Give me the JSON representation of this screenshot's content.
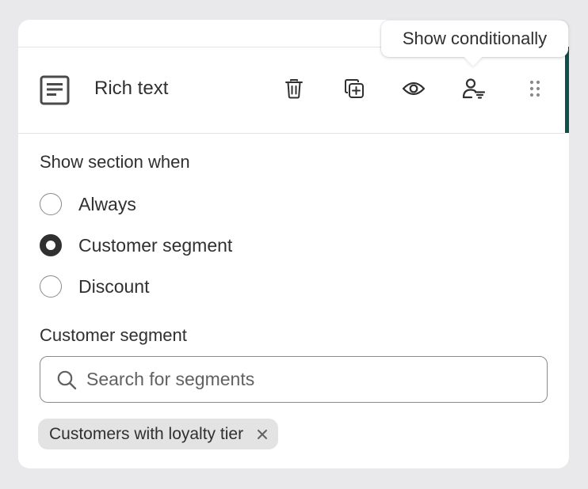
{
  "tooltip": {
    "text": "Show conditionally"
  },
  "section": {
    "title": "Rich text",
    "icon": "text-block-icon",
    "actions": [
      {
        "name": "delete",
        "icon": "trash-icon"
      },
      {
        "name": "duplicate",
        "icon": "duplicate-icon"
      },
      {
        "name": "visibility",
        "icon": "eye-icon"
      },
      {
        "name": "show-conditionally",
        "icon": "person-filter-icon"
      },
      {
        "name": "drag",
        "icon": "drag-handle-icon"
      }
    ]
  },
  "condition": {
    "heading": "Show section when",
    "options": [
      {
        "label": "Always",
        "checked": false
      },
      {
        "label": "Customer segment",
        "checked": true
      },
      {
        "label": "Discount",
        "checked": false
      }
    ]
  },
  "segment": {
    "heading": "Customer segment",
    "search_placeholder": "Search for segments",
    "search_value": "",
    "selected": [
      {
        "label": "Customers with loyalty tier"
      }
    ]
  },
  "colors": {
    "accent": "#0d4f4a",
    "background": "#e9e8ea",
    "text": "#303030",
    "chip": "#e3e3e3"
  }
}
